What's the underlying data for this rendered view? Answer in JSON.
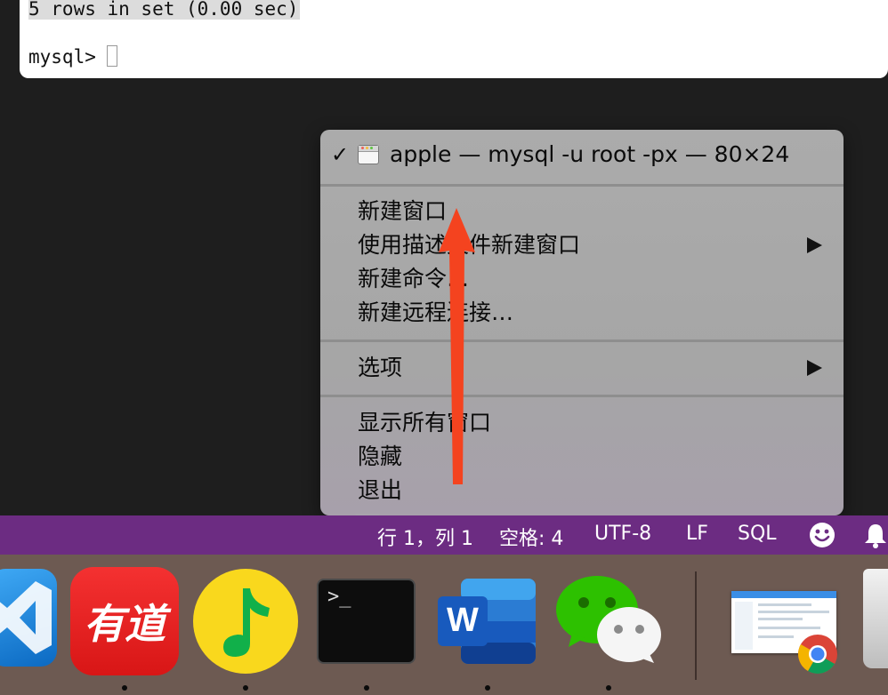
{
  "terminal": {
    "line1": "5 rows in set (0.00 sec)",
    "prompt": "mysql>"
  },
  "menu": {
    "checkmark": "✓",
    "window_title": "apple — mysql -u root -px — 80×24",
    "items": [
      {
        "label": "新建窗口",
        "submenu": false
      },
      {
        "label": "使用描述文件新建窗口",
        "submenu": true
      },
      {
        "label": "新建命令…",
        "submenu": false
      },
      {
        "label": "新建远程连接…",
        "submenu": false
      },
      {
        "label": "选项",
        "submenu": true
      },
      {
        "label": "显示所有窗口",
        "submenu": false
      },
      {
        "label": "隐藏",
        "submenu": false
      },
      {
        "label": "退出",
        "submenu": false
      }
    ]
  },
  "statusbar": {
    "position": "行 1，列 1",
    "spaces": "空格: 4",
    "encoding": "UTF-8",
    "eol": "LF",
    "language": "SQL",
    "feedback_icon": "smiley-icon",
    "notification_icon": "bell-icon"
  },
  "dock": {
    "apps": [
      {
        "name": "Visual Studio Code",
        "icon": "vscode-icon"
      },
      {
        "name": "有道",
        "icon": "youdao-icon",
        "glyph": "有道"
      },
      {
        "name": "QQ音乐",
        "icon": "qq-music-icon"
      },
      {
        "name": "Terminal",
        "icon": "terminal-icon",
        "glyph": ">_"
      },
      {
        "name": "Microsoft Word",
        "icon": "word-icon",
        "glyph": "W"
      },
      {
        "name": "WeChat",
        "icon": "wechat-icon"
      },
      {
        "name": "Screenshot",
        "icon": "screenshot-thumbnail-icon"
      },
      {
        "name": "Google Chrome",
        "icon": "chrome-icon"
      },
      {
        "name": "Trash",
        "icon": "trash-icon"
      }
    ]
  },
  "colors": {
    "statusbar_bg": "#6c2c82",
    "dock_bg": "#6d5a52",
    "annotation_arrow": "#f4431f",
    "menu_bg": "#ababab"
  }
}
